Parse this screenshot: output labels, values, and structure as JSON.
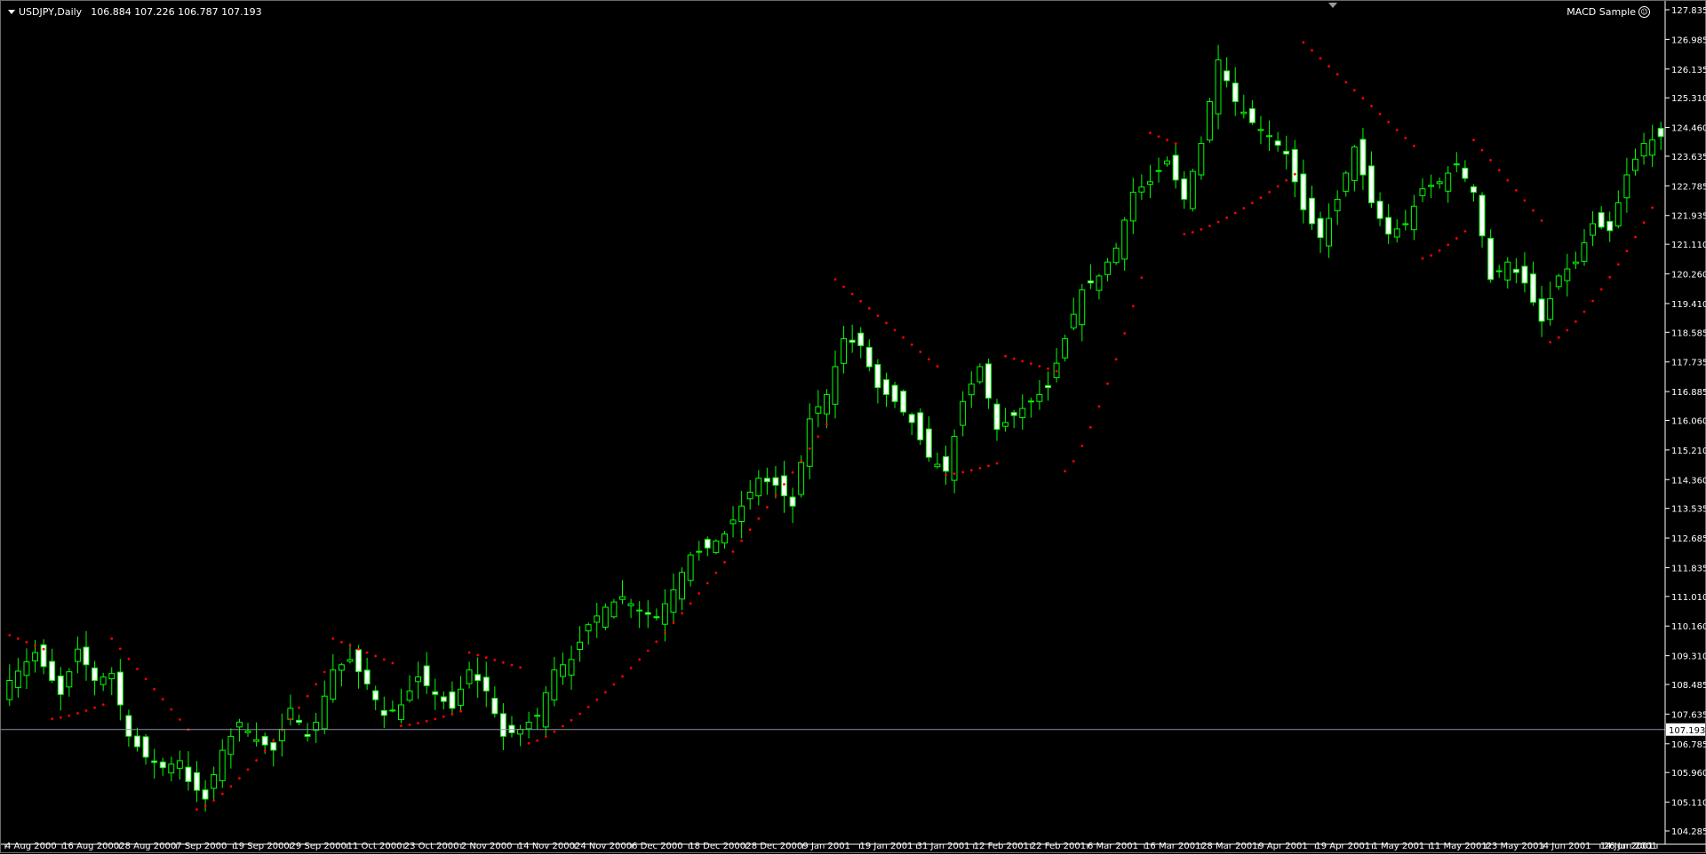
{
  "header": {
    "symbol": "USDJPY,Daily",
    "ohlc": "106.884 107.226 106.787 107.193",
    "expert_name": "MACD Sample",
    "expert_icon": "smiley-icon"
  },
  "colors": {
    "background": "#000000",
    "candle_bull_body": "#000000",
    "candle_bear_body": "#ffffff",
    "candle_outline": "#00ff00",
    "sar_dot": "#ff0000",
    "bid_line": "#8a93a8",
    "axis_text": "#ffffff",
    "price_tag_bg": "#ffffff",
    "price_tag_text": "#000000"
  },
  "chart_data": {
    "type": "candlestick",
    "ylim": [
      104.285,
      127.835
    ],
    "y_ticks": [
      "127.835",
      "126.985",
      "126.135",
      "125.310",
      "124.460",
      "123.635",
      "122.785",
      "121.935",
      "121.110",
      "120.260",
      "119.410",
      "118.585",
      "117.735",
      "116.885",
      "116.060",
      "115.210",
      "114.360",
      "113.535",
      "112.685",
      "111.835",
      "111.010",
      "110.160",
      "109.310",
      "108.485",
      "107.635",
      "106.785",
      "105.960",
      "105.110",
      "104.285"
    ],
    "current_price": "107.193",
    "x_labels": [
      "4 Aug 2000",
      "16 Aug 2000",
      "28 Aug 2000",
      "7 Sep 2000",
      "19 Sep 2000",
      "29 Sep 2000",
      "11 Oct 2000",
      "23 Oct 2000",
      "2 Nov 2000",
      "14 Nov 2000",
      "24 Nov 2000",
      "6 Dec 2000",
      "18 Dec 2000",
      "28 Dec 2000",
      "9 Jan 2001",
      "19 Jan 2001",
      "31 Jan 2001",
      "12 Feb 2001",
      "22 Feb 2001",
      "6 Mar 2001",
      "16 Mar 2001",
      "28 Mar 2001",
      "9 Apr 2001",
      "19 Apr 2001",
      "1 May 2001",
      "11 May 2001",
      "23 May 2001",
      "4 Jun 2001",
      "14 Jun 2001",
      "26 Jun 2001"
    ],
    "close_path": [
      [
        0,
        108.6
      ],
      [
        3,
        109.4
      ],
      [
        6,
        108.2
      ],
      [
        8,
        109.5
      ],
      [
        10,
        108.6
      ],
      [
        12,
        108.8
      ],
      [
        14,
        107.0
      ],
      [
        16,
        106.4
      ],
      [
        18,
        106.1
      ],
      [
        20,
        106.3
      ],
      [
        21,
        105.7
      ],
      [
        23,
        105.2
      ],
      [
        25,
        106.6
      ],
      [
        27,
        107.4
      ],
      [
        29,
        106.9
      ],
      [
        31,
        106.6
      ],
      [
        33,
        107.8
      ],
      [
        35,
        107.0
      ],
      [
        36,
        107.4
      ],
      [
        38,
        108.9
      ],
      [
        40,
        109.2
      ],
      [
        42,
        108.5
      ],
      [
        44,
        107.6
      ],
      [
        46,
        107.9
      ],
      [
        48,
        108.7
      ],
      [
        50,
        108.2
      ],
      [
        52,
        107.8
      ],
      [
        54,
        108.9
      ],
      [
        56,
        108.3
      ],
      [
        58,
        107.0
      ],
      [
        60,
        107.2
      ],
      [
        62,
        107.6
      ],
      [
        64,
        108.9
      ],
      [
        66,
        109.2
      ],
      [
        68,
        110.2
      ],
      [
        70,
        110.7
      ],
      [
        72,
        111.0
      ],
      [
        74,
        110.6
      ],
      [
        76,
        110.4
      ],
      [
        78,
        111.2
      ],
      [
        80,
        112.2
      ],
      [
        82,
        112.4
      ],
      [
        84,
        112.8
      ],
      [
        86,
        113.6
      ],
      [
        88,
        114.4
      ],
      [
        90,
        114.2
      ],
      [
        92,
        113.6
      ],
      [
        94,
        116.1
      ],
      [
        96,
        116.8
      ],
      [
        98,
        118.4
      ],
      [
        100,
        118.2
      ],
      [
        102,
        117.0
      ],
      [
        104,
        116.6
      ],
      [
        106,
        116.0
      ],
      [
        108,
        115.0
      ],
      [
        110,
        114.6
      ],
      [
        112,
        116.6
      ],
      [
        114,
        117.6
      ],
      [
        116,
        115.8
      ],
      [
        118,
        116.2
      ],
      [
        120,
        116.6
      ],
      [
        122,
        117.0
      ],
      [
        124,
        118.4
      ],
      [
        126,
        119.8
      ],
      [
        128,
        120.2
      ],
      [
        130,
        121.0
      ],
      [
        132,
        122.6
      ],
      [
        134,
        122.9
      ],
      [
        136,
        123.5
      ],
      [
        138,
        122.4
      ],
      [
        140,
        124.0
      ],
      [
        142,
        126.4
      ],
      [
        144,
        125.2
      ],
      [
        146,
        124.6
      ],
      [
        148,
        124.2
      ],
      [
        150,
        123.7
      ],
      [
        152,
        122.1
      ],
      [
        154,
        121.3
      ],
      [
        156,
        122.4
      ],
      [
        158,
        123.9
      ],
      [
        160,
        122.3
      ],
      [
        162,
        121.4
      ],
      [
        164,
        121.7
      ],
      [
        166,
        122.7
      ],
      [
        168,
        122.9
      ],
      [
        170,
        123.4
      ],
      [
        172,
        122.6
      ],
      [
        174,
        120.1
      ],
      [
        176,
        120.6
      ],
      [
        178,
        120.0
      ],
      [
        180,
        118.9
      ],
      [
        182,
        120.2
      ],
      [
        184,
        120.6
      ],
      [
        186,
        121.7
      ],
      [
        188,
        121.5
      ],
      [
        190,
        123.1
      ],
      [
        192,
        124.0
      ],
      [
        194,
        124.2
      ]
    ],
    "sar_segments": [
      {
        "from": 0,
        "to": 5,
        "start": 109.9,
        "end": 109.4
      },
      {
        "from": 5,
        "to": 12,
        "start": 107.5,
        "end": 108.0
      },
      {
        "from": 12,
        "to": 22,
        "start": 109.8,
        "end": 106.9
      },
      {
        "from": 22,
        "to": 38,
        "start": 104.9,
        "end": 109.2
      },
      {
        "from": 38,
        "to": 46,
        "start": 109.8,
        "end": 109.0
      },
      {
        "from": 46,
        "to": 54,
        "start": 107.3,
        "end": 107.8
      },
      {
        "from": 54,
        "to": 61,
        "start": 109.4,
        "end": 108.9
      },
      {
        "from": 61,
        "to": 97,
        "start": 106.8,
        "end": 116.3
      },
      {
        "from": 97,
        "to": 110,
        "start": 120.1,
        "end": 117.4
      },
      {
        "from": 110,
        "to": 117,
        "start": 114.5,
        "end": 114.9
      },
      {
        "from": 117,
        "to": 124,
        "start": 117.9,
        "end": 117.4
      },
      {
        "from": 124,
        "to": 134,
        "start": 114.6,
        "end": 121.0
      },
      {
        "from": 134,
        "to": 138,
        "start": 124.3,
        "end": 123.9
      },
      {
        "from": 138,
        "to": 152,
        "start": 121.4,
        "end": 123.3
      },
      {
        "from": 152,
        "to": 166,
        "start": 126.9,
        "end": 123.7
      },
      {
        "from": 166,
        "to": 172,
        "start": 120.7,
        "end": 121.7
      },
      {
        "from": 172,
        "to": 181,
        "start": 124.1,
        "end": 121.5
      },
      {
        "from": 181,
        "to": 194,
        "start": 118.3,
        "end": 122.6
      }
    ]
  }
}
